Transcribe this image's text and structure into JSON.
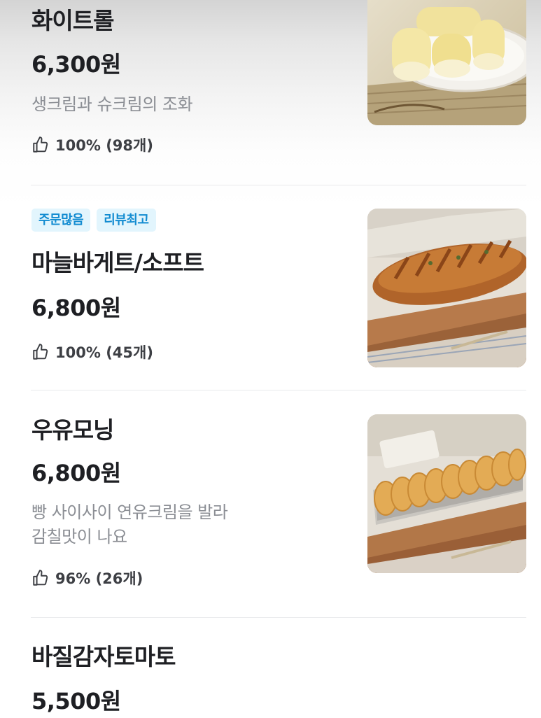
{
  "menu": {
    "items": [
      {
        "name": "화이트롤",
        "price": "6,300원",
        "description_lines": [
          "생크림과 슈크림의 조화"
        ],
        "badges": [],
        "rating": "100% (98개)",
        "image": "white-roll-photo"
      },
      {
        "name": "마늘바게트/소프트",
        "price": "6,800원",
        "description_lines": [],
        "badges": [
          "주문많음",
          "리뷰최고"
        ],
        "rating": "100% (45개)",
        "image": "garlic-baguette-photo"
      },
      {
        "name": "우유모닝",
        "price": "6,800원",
        "description_lines": [
          "빵 사이사이 연유크림을 발라",
          "감칠맛이 나요"
        ],
        "badges": [],
        "rating": "96% (26개)",
        "image": "milk-morning-bread-photo"
      },
      {
        "name": "바질감자토마토",
        "price": "5,500원",
        "description_lines": [],
        "badges": [],
        "rating": "",
        "image": ""
      }
    ]
  },
  "icons": {
    "rating": "thumbs-up-icon"
  },
  "colors": {
    "badge_background": "#e2f5fd",
    "badge_text": "#138cd1",
    "description_text": "#8b8e94",
    "divider": "#e9eaec"
  }
}
